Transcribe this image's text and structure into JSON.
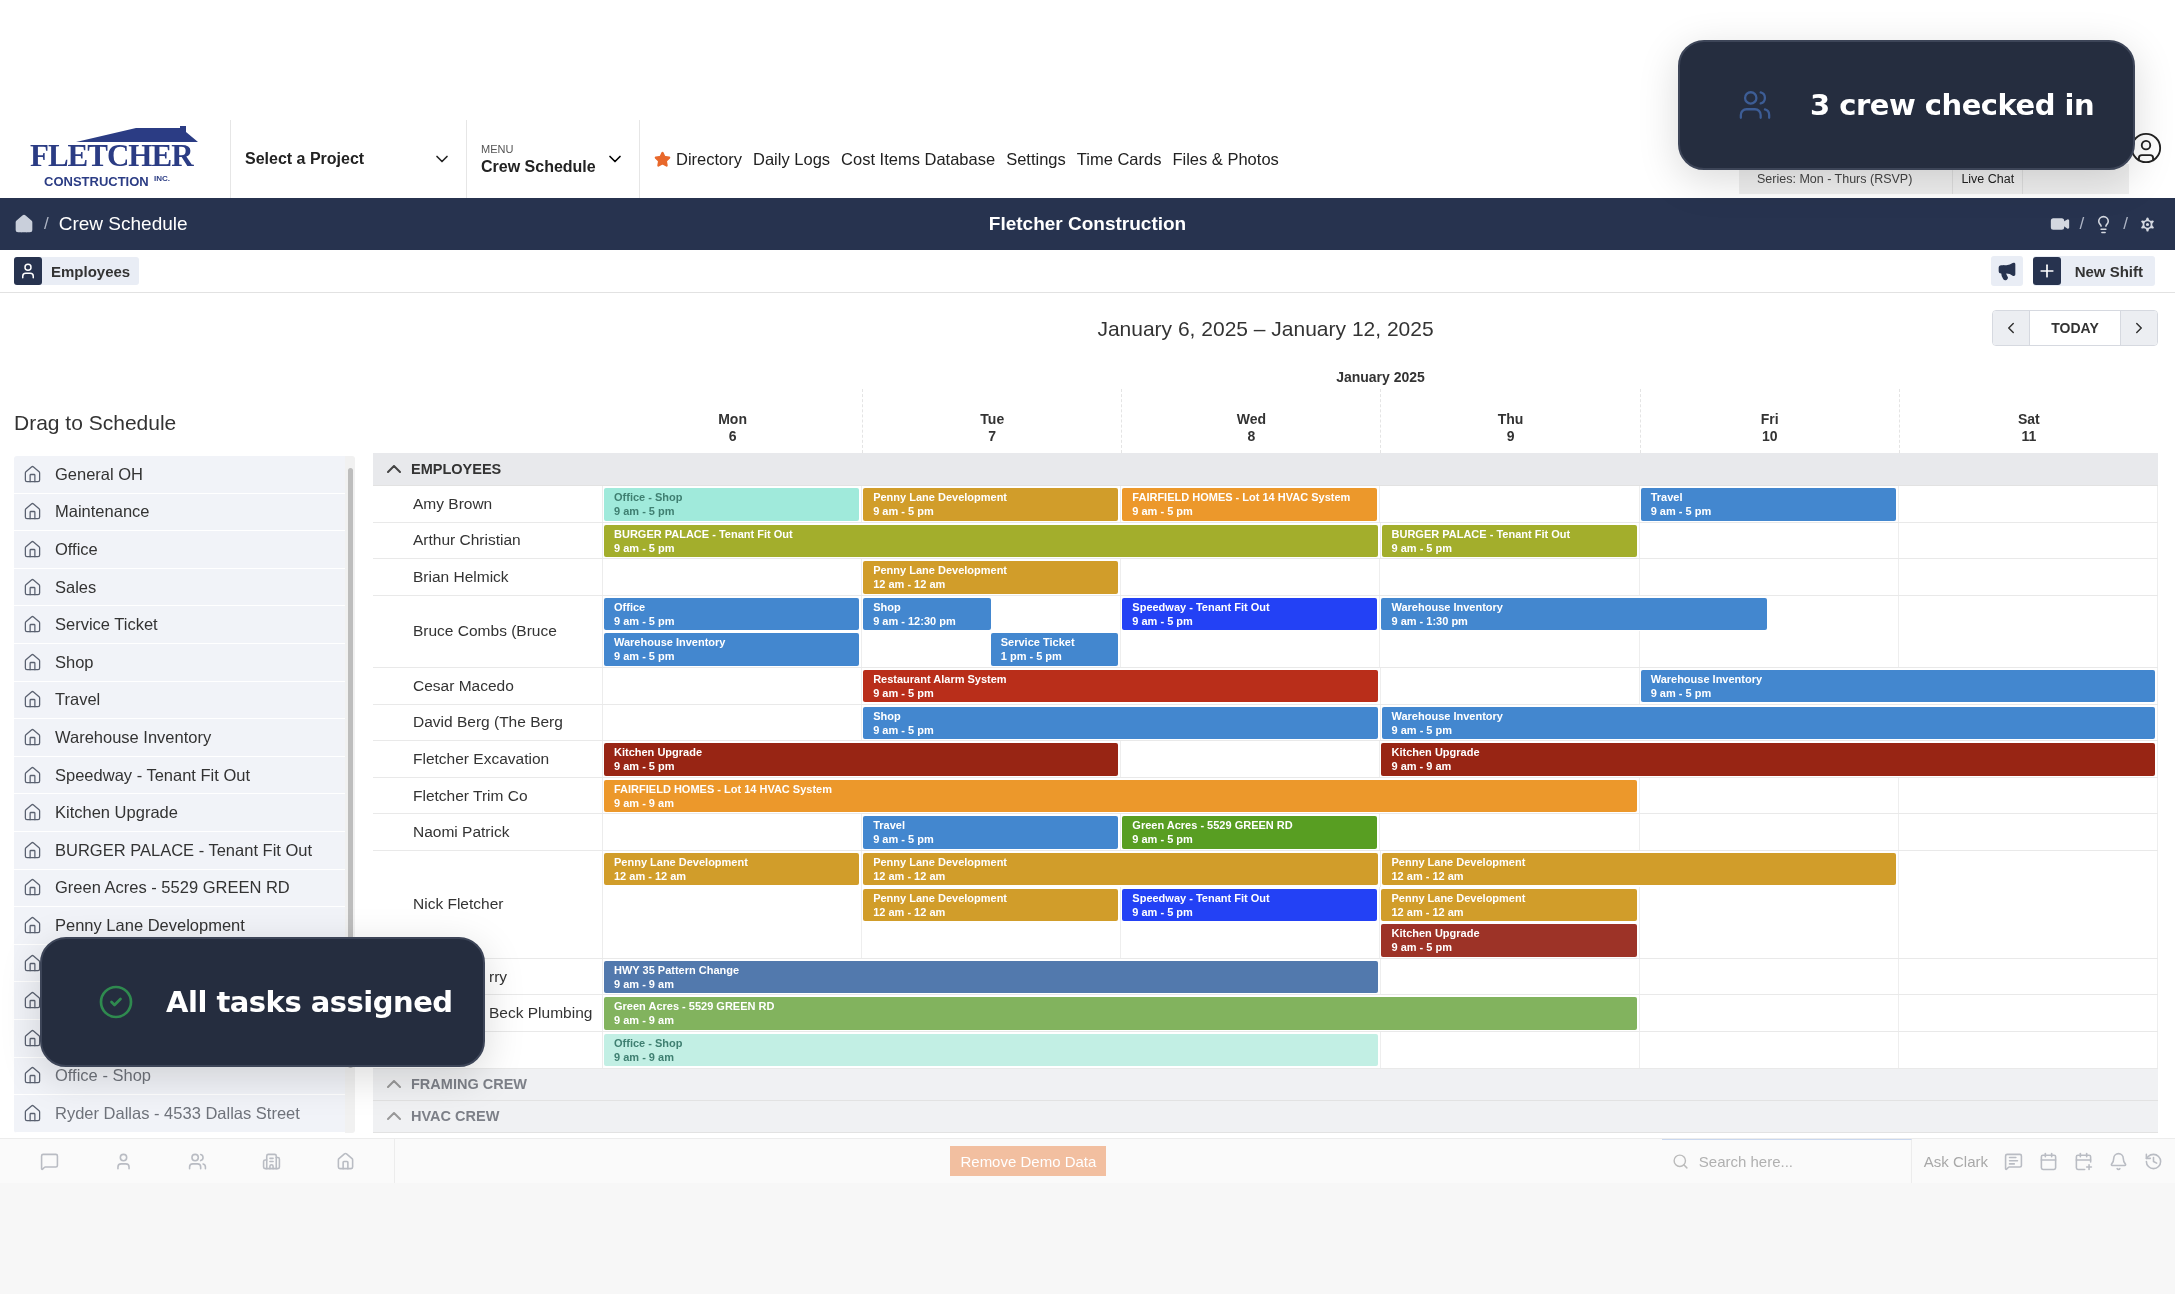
{
  "header": {
    "logo": {
      "name": "FLETCHER",
      "sub": "CONSTRUCTION",
      "suffix": "INC."
    },
    "project_select": {
      "label": "Select a Project"
    },
    "menu": {
      "caption": "MENU",
      "value": "Crew Schedule"
    },
    "nav_links": [
      {
        "label": "Directory",
        "starred": true
      },
      {
        "label": "Daily Logs",
        "starred": false
      },
      {
        "label": "Cost Items Database",
        "starred": false
      },
      {
        "label": "Settings",
        "starred": false
      },
      {
        "label": "Time Cards",
        "starred": false
      },
      {
        "label": "Files & Photos",
        "starred": false
      }
    ],
    "series": "Series: Mon - Thurs (RSVP)",
    "live_chat": "Live Chat"
  },
  "title_bar": {
    "separator": "/",
    "breadcrumb": "Crew Schedule",
    "title": "Fletcher Construction"
  },
  "toolbar": {
    "view_button": "Employees",
    "new_shift": "New Shift"
  },
  "date_range": "January 6, 2025 – January 12, 2025",
  "pager": {
    "today": "TODAY"
  },
  "month": "January 2025",
  "days": [
    {
      "name": "Mon",
      "date": "6"
    },
    {
      "name": "Tue",
      "date": "7"
    },
    {
      "name": "Wed",
      "date": "8"
    },
    {
      "name": "Thu",
      "date": "9"
    },
    {
      "name": "Fri",
      "date": "10"
    },
    {
      "name": "Sat",
      "date": "11"
    }
  ],
  "sidebar": {
    "title": "Drag to Schedule",
    "items": [
      {
        "label": "General OH"
      },
      {
        "label": "Maintenance"
      },
      {
        "label": "Office"
      },
      {
        "label": "Sales"
      },
      {
        "label": "Service Ticket"
      },
      {
        "label": "Shop"
      },
      {
        "label": "Travel"
      },
      {
        "label": "Warehouse Inventory"
      },
      {
        "label": "Speedway - Tenant Fit Out"
      },
      {
        "label": "Kitchen Upgrade"
      },
      {
        "label": "BURGER PALACE - Tenant Fit Out"
      },
      {
        "label": "Green Acres - 5529 GREEN RD"
      },
      {
        "label": "Penny Lane Development"
      },
      {
        "covered": true
      },
      {
        "covered": true
      },
      {
        "covered": true
      },
      {
        "label": "Office - Shop"
      },
      {
        "label": "Ryder Dallas - 4533 Dallas Street"
      }
    ]
  },
  "groups": [
    {
      "name": "EMPLOYEES",
      "rows": [
        {
          "name": "Amy Brown",
          "lanes": [
            [
              {
                "kind": "shift",
                "title": "Office - Shop",
                "time": "9 am - 5 pm",
                "color": "#a0eadb"
              },
              {
                "kind": "shift",
                "title": "Penny Lane Development",
                "time": "9 am - 5 pm",
                "color": "#d19d2a"
              },
              {
                "kind": "shift",
                "title": "FAIRFIELD HOMES - Lot 14 HVAC System",
                "time": "9 am - 5 pm",
                "color": "#ec982b"
              },
              {
                "kind": "empty"
              },
              {
                "kind": "shift",
                "title": "Travel",
                "time": "9 am - 5 pm",
                "color": "#4387cf"
              },
              {
                "kind": "empty"
              }
            ]
          ]
        },
        {
          "name": "Arthur Christian",
          "lanes": [
            [
              {
                "kind": "shift",
                "title": "BURGER PALACE - Tenant Fit Out",
                "time": "9 am - 5 pm",
                "color": "#a3ae2c"
              },
              {
                "kind": "continued"
              },
              {
                "kind": "continued"
              },
              {
                "kind": "shift",
                "title": "BURGER PALACE - Tenant Fit Out",
                "time": "9 am - 5 pm",
                "color": "#a3ae2c"
              },
              {
                "kind": "empty"
              },
              {
                "kind": "empty"
              }
            ]
          ]
        },
        {
          "name": "Brian Helmick",
          "lanes": [
            [
              {
                "kind": "empty"
              },
              {
                "kind": "shift",
                "title": "Penny Lane Development",
                "time": "12 am - 12 am",
                "color": "#d19d2a"
              },
              {
                "kind": "empty"
              },
              {
                "kind": "empty"
              },
              {
                "kind": "empty"
              },
              {
                "kind": "empty"
              }
            ]
          ]
        },
        {
          "name": "Bruce Combs (Bruce",
          "lanes": [
            [
              {
                "kind": "shift",
                "title": "Office",
                "time": "9 am - 5 pm",
                "color": "#4387cf"
              },
              {
                "kind": "shift",
                "title": "Shop",
                "time": "9 am - 12:30 pm",
                "ends_early": true,
                "color": "#4387cf"
              },
              {
                "kind": "shift",
                "title": "Speedway - Tenant Fit Out",
                "time": "9 am - 5 pm",
                "color": "#2341f5"
              },
              {
                "kind": "shift",
                "title": "Warehouse Inventory",
                "time": "9 am - 1:30 pm",
                "ends_early": true,
                "color": "#4387cf"
              },
              {
                "kind": "continued"
              },
              {
                "kind": "empty"
              }
            ],
            [
              {
                "kind": "shift",
                "title": "Warehouse Inventory",
                "time": "9 am - 5 pm",
                "color": "#4387cf"
              },
              {
                "kind": "shift",
                "title": "Service Ticket",
                "time": "1 pm - 5 pm",
                "starts_late": true,
                "color": "#4387cf"
              },
              {
                "kind": "empty"
              },
              {
                "kind": "empty"
              },
              {
                "kind": "empty"
              },
              {
                "kind": "empty"
              }
            ]
          ]
        },
        {
          "name": "Cesar Macedo",
          "lanes": [
            [
              {
                "kind": "empty"
              },
              {
                "kind": "shift",
                "title": "Restaurant Alarm System",
                "time": "9 am - 5 pm",
                "color": "#b92e1a"
              },
              {
                "kind": "continued"
              },
              {
                "kind": "empty"
              },
              {
                "kind": "shift",
                "title": "Warehouse Inventory",
                "time": "9 am - 5 pm",
                "color": "#4387cf"
              },
              {
                "kind": "continued"
              }
            ]
          ]
        },
        {
          "name": "David Berg (The Berg",
          "lanes": [
            [
              {
                "kind": "empty"
              },
              {
                "kind": "shift",
                "title": "Shop",
                "time": "9 am - 5 pm",
                "color": "#4387cf"
              },
              {
                "kind": "continued"
              },
              {
                "kind": "shift",
                "title": "Warehouse Inventory",
                "time": "9 am - 5 pm",
                "color": "#4387cf"
              },
              {
                "kind": "continued"
              },
              {
                "kind": "continued"
              }
            ]
          ]
        },
        {
          "name": "Fletcher Excavation",
          "lanes": [
            [
              {
                "kind": "shift",
                "title": "Kitchen Upgrade",
                "time": "9 am - 5 pm",
                "color": "#982514"
              },
              {
                "kind": "continued"
              },
              {
                "kind": "empty"
              },
              {
                "kind": "shift",
                "title": "Kitchen Upgrade",
                "time": "9 am - 9 am",
                "color": "#982514"
              },
              {
                "kind": "continued"
              },
              {
                "kind": "continued"
              }
            ]
          ]
        },
        {
          "name": "Fletcher Trim Co",
          "lanes": [
            [
              {
                "kind": "shift",
                "title": "FAIRFIELD HOMES - Lot 14 HVAC System",
                "time": "9 am - 9 am",
                "color": "#ec982b"
              },
              {
                "kind": "continued"
              },
              {
                "kind": "continued"
              },
              {
                "kind": "continued"
              },
              {
                "kind": "empty"
              },
              {
                "kind": "empty"
              }
            ]
          ]
        },
        {
          "name": "Naomi Patrick",
          "lanes": [
            [
              {
                "kind": "empty"
              },
              {
                "kind": "shift",
                "title": "Travel",
                "time": "9 am - 5 pm",
                "color": "#4387cf"
              },
              {
                "kind": "shift",
                "title": "Green Acres - 5529 GREEN RD",
                "time": "9 am - 5 pm",
                "color": "#589e22"
              },
              {
                "kind": "empty"
              },
              {
                "kind": "empty"
              },
              {
                "kind": "empty"
              }
            ]
          ]
        },
        {
          "name": "Nick Fletcher",
          "lanes": [
            [
              {
                "kind": "shift",
                "title": "Penny Lane Development",
                "time": "12 am - 12 am",
                "color": "#d19d2a"
              },
              {
                "kind": "shift",
                "title": "Penny Lane Development",
                "time": "12 am - 12 am",
                "color": "#d19d2a"
              },
              {
                "kind": "continued"
              },
              {
                "kind": "shift",
                "title": "Penny Lane Development",
                "time": "12 am - 12 am",
                "color": "#d19d2a"
              },
              {
                "kind": "continued"
              },
              {
                "kind": "empty"
              }
            ],
            [
              {
                "kind": "empty"
              },
              {
                "kind": "shift",
                "title": "Penny Lane Development",
                "time": "12 am - 12 am",
                "color": "#d19d2a"
              },
              {
                "kind": "shift",
                "title": "Speedway - Tenant Fit Out",
                "time": "9 am - 5 pm",
                "color": "#2341f5"
              },
              {
                "kind": "shift",
                "title": "Penny Lane Development",
                "time": "12 am - 12 am",
                "color": "#d19d2a"
              },
              {
                "kind": "empty"
              },
              {
                "kind": "empty"
              }
            ],
            [
              {
                "kind": "empty"
              },
              {
                "kind": "empty"
              },
              {
                "kind": "empty"
              },
              {
                "kind": "shift",
                "title": "Kitchen Upgrade",
                "time": "9 am - 5 pm",
                "color": "#9d3327"
              },
              {
                "kind": "empty"
              },
              {
                "kind": "empty"
              }
            ]
          ]
        },
        {
          "name": "rry",
          "partly_hidden": true,
          "lanes": [
            [
              {
                "kind": "shift",
                "title": "HWY 35 Pattern Change",
                "time": "9 am - 9 am",
                "color": "#5279ad"
              },
              {
                "kind": "continued"
              },
              {
                "kind": "continued"
              },
              {
                "kind": "empty"
              },
              {
                "kind": "empty"
              },
              {
                "kind": "empty"
              }
            ]
          ]
        },
        {
          "name": "Beck Plumbing",
          "partly_hidden": true,
          "lanes": [
            [
              {
                "kind": "shift",
                "title": "Green Acres - 5529 GREEN RD",
                "time": "9 am - 9 am",
                "color": "#82b35e"
              },
              {
                "kind": "continued"
              },
              {
                "kind": "continued"
              },
              {
                "kind": "continued"
              },
              {
                "kind": "empty"
              },
              {
                "kind": "empty"
              }
            ]
          ]
        },
        {
          "lanes": [
            [
              {
                "kind": "shift",
                "title": "Office - Shop",
                "time": "9 am - 9 am",
                "color": "#c2efe4"
              },
              {
                "kind": "continued"
              },
              {
                "kind": "continued"
              },
              {
                "kind": "empty"
              },
              {
                "kind": "empty"
              },
              {
                "kind": "empty"
              }
            ]
          ]
        }
      ]
    },
    {
      "name": "FRAMING CREW"
    },
    {
      "name": "HVAC CREW"
    }
  ],
  "bottom_bar": {
    "demo_button": "Remove Demo Data",
    "search": {
      "placeholder": "Search here..."
    },
    "assistant": "Ask Clark"
  },
  "toasts": [
    {
      "kind": "crew",
      "text": "3 crew checked in"
    },
    {
      "kind": "success",
      "text": "All tasks assigned"
    }
  ]
}
